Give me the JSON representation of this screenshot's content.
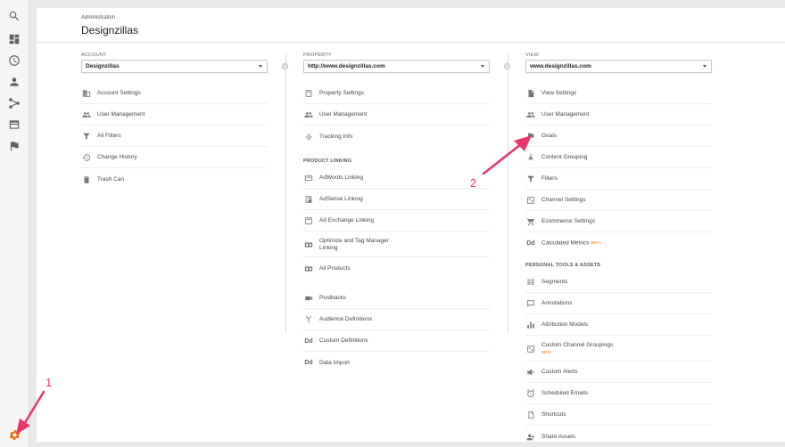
{
  "header": {
    "small": "Administration",
    "title": "Designzillas"
  },
  "account": {
    "label": "ACCOUNT",
    "selected": "Designzillas",
    "items": [
      "Account Settings",
      "User Management",
      "All Filters",
      "Change History",
      "Trash Can"
    ]
  },
  "property": {
    "label": "PROPERTY",
    "selected": "http://www.designzillas.com",
    "items": [
      "Property Settings",
      "User Management",
      "Tracking Info"
    ],
    "linking_label": "PRODUCT LINKING",
    "linking": [
      "AdWords Linking",
      "AdSense Linking",
      "Ad Exchange Linking",
      "Optimize and Tag Manager Linking",
      "All Products"
    ],
    "other": [
      "Postbacks",
      "Audience Definitions",
      "Custom Definitions",
      "Data Import"
    ]
  },
  "view": {
    "label": "VIEW",
    "selected": "www.designzillas.com",
    "items": [
      "View Settings",
      "User Management",
      "Goals",
      "Content Grouping",
      "Filters",
      "Channel Settings",
      "Ecommerce Settings",
      "Calculated Metrics"
    ],
    "beta": "BETA",
    "tools_label": "PERSONAL TOOLS & ASSETS",
    "tools": [
      "Segments",
      "Annotations",
      "Attribution Models",
      "Custom Channel Groupings",
      "Custom Alerts",
      "Scheduled Emails",
      "Shortcuts",
      "Share Assets"
    ]
  },
  "annotations": {
    "one": "1",
    "two": "2"
  },
  "icons": {
    "sidebar": [
      "search-icon",
      "dashboard-icon",
      "clock-icon",
      "person-icon",
      "acquisition-icon",
      "behavior-icon",
      "flag-icon",
      "gear-icon"
    ],
    "accent": "#e8710a",
    "annotation_color": "#e8356c"
  }
}
